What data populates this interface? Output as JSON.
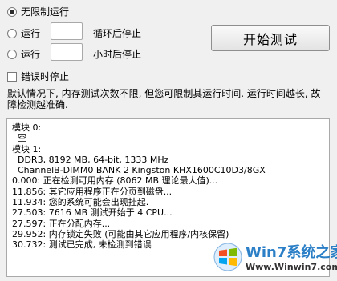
{
  "options": {
    "unlimited_label": "无限制运行",
    "run_label_1": "运行",
    "loops_suffix": "循环后停止",
    "run_label_2": "运行",
    "hours_suffix": "小时后停止",
    "stop_on_error_label": "错误时停止",
    "loops_value": "",
    "hours_value": ""
  },
  "start_button_label": "开始测试",
  "info_text": "默认情况下, 内存测试次数不限, 但您可限制其运行时间. 运行时间越长, 故障检测越准确.",
  "log": [
    "模块 0:",
    "  空",
    "模块 1:",
    "  DDR3, 8192 MB, 64-bit, 1333 MHz",
    "  ChannelB-DIMM0 BANK 2 Kingston KHX1600C10D3/8GX",
    "",
    "0.000: 正在检测可用内存 (8062 MB 理论最大值)...",
    "11.856: 其它应用程序正在分页到磁盘...",
    "11.934: 您的系统可能会出现挂起.",
    "27.503: 7616 MB 测试开始于 4 CPU...",
    "27.597: 正在分配内存...",
    "29.952: 内存锁定失败 (可能由其它应用程序/内核保留)",
    "30.732: 测试已完成, 未检测到错误"
  ],
  "watermark": {
    "title": "Win7系统之家",
    "url": "Www.Winwin7.com"
  }
}
